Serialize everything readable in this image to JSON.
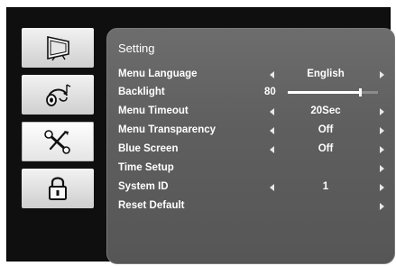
{
  "sidebar": {
    "items": [
      {
        "name": "picture",
        "icon": "monitor-icon"
      },
      {
        "name": "audio",
        "icon": "headphones-icon"
      },
      {
        "name": "setting",
        "icon": "wrench-screwdriver-icon",
        "active": true
      },
      {
        "name": "lock",
        "icon": "padlock-icon"
      }
    ]
  },
  "panel": {
    "title": "Setting",
    "rows": [
      {
        "label": "Menu Language",
        "value": "English",
        "arrows": "both"
      },
      {
        "label": "Backlight",
        "value": "80",
        "level": 0.8,
        "type": "slider"
      },
      {
        "label": "Menu Timeout",
        "value": "20Sec",
        "arrows": "both"
      },
      {
        "label": "Menu Transparency",
        "value": "Off",
        "arrows": "both"
      },
      {
        "label": "Blue Screen",
        "value": "Off",
        "arrows": "both"
      },
      {
        "label": "Time Setup",
        "arrows": "right"
      },
      {
        "label": "System ID",
        "value": "1",
        "arrows": "both"
      },
      {
        "label": "Reset Default",
        "arrows": "right"
      }
    ]
  },
  "colors": {
    "panel": "#5f5f5f",
    "text": "#ffffff",
    "frame": "#0f0f0f"
  }
}
